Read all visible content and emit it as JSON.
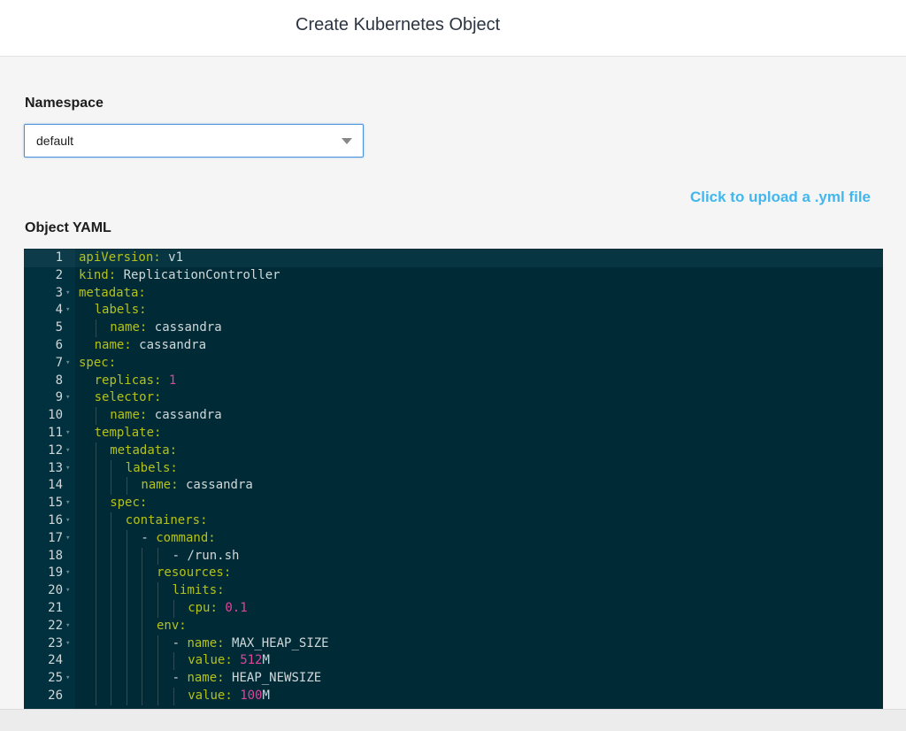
{
  "header": {
    "title": "Create Kubernetes Object"
  },
  "namespace": {
    "label": "Namespace",
    "selected": "default"
  },
  "upload": {
    "label": "Click to upload a .yml file"
  },
  "yaml": {
    "label": "Object YAML",
    "lines": [
      {
        "n": "1",
        "fold": false,
        "indent": 0,
        "parts": [
          [
            "k",
            "apiVersion:"
          ],
          [
            "v",
            " v1"
          ]
        ]
      },
      {
        "n": "2",
        "fold": false,
        "indent": 0,
        "parts": [
          [
            "k",
            "kind:"
          ],
          [
            "v",
            " ReplicationController"
          ]
        ]
      },
      {
        "n": "3",
        "fold": true,
        "indent": 0,
        "parts": [
          [
            "k",
            "metadata:"
          ]
        ]
      },
      {
        "n": "4",
        "fold": true,
        "indent": 1,
        "parts": [
          [
            "k",
            "labels:"
          ]
        ]
      },
      {
        "n": "5",
        "fold": false,
        "indent": 2,
        "parts": [
          [
            "k",
            "name:"
          ],
          [
            "v",
            " cassandra"
          ]
        ]
      },
      {
        "n": "6",
        "fold": false,
        "indent": 1,
        "parts": [
          [
            "k",
            "name:"
          ],
          [
            "v",
            " cassandra"
          ]
        ]
      },
      {
        "n": "7",
        "fold": true,
        "indent": 0,
        "parts": [
          [
            "k",
            "spec:"
          ]
        ]
      },
      {
        "n": "8",
        "fold": false,
        "indent": 1,
        "parts": [
          [
            "k",
            "replicas:"
          ],
          [
            "n",
            " 1"
          ]
        ]
      },
      {
        "n": "9",
        "fold": true,
        "indent": 1,
        "parts": [
          [
            "k",
            "selector:"
          ]
        ]
      },
      {
        "n": "10",
        "fold": false,
        "indent": 2,
        "parts": [
          [
            "k",
            "name:"
          ],
          [
            "v",
            " cassandra"
          ]
        ]
      },
      {
        "n": "11",
        "fold": true,
        "indent": 1,
        "parts": [
          [
            "k",
            "template:"
          ]
        ]
      },
      {
        "n": "12",
        "fold": true,
        "indent": 2,
        "parts": [
          [
            "k",
            "metadata:"
          ]
        ]
      },
      {
        "n": "13",
        "fold": true,
        "indent": 3,
        "parts": [
          [
            "k",
            "labels:"
          ]
        ]
      },
      {
        "n": "14",
        "fold": false,
        "indent": 4,
        "parts": [
          [
            "k",
            "name:"
          ],
          [
            "v",
            " cassandra"
          ]
        ]
      },
      {
        "n": "15",
        "fold": true,
        "indent": 2,
        "parts": [
          [
            "k",
            "spec:"
          ]
        ]
      },
      {
        "n": "16",
        "fold": true,
        "indent": 3,
        "parts": [
          [
            "k",
            "containers:"
          ]
        ]
      },
      {
        "n": "17",
        "fold": true,
        "indent": 4,
        "parts": [
          [
            "v",
            "- "
          ],
          [
            "k",
            "command:"
          ]
        ]
      },
      {
        "n": "18",
        "fold": false,
        "indent": 6,
        "parts": [
          [
            "v",
            "- /run.sh"
          ]
        ]
      },
      {
        "n": "19",
        "fold": true,
        "indent": 5,
        "parts": [
          [
            "k",
            "resources:"
          ]
        ]
      },
      {
        "n": "20",
        "fold": true,
        "indent": 6,
        "parts": [
          [
            "k",
            "limits:"
          ]
        ]
      },
      {
        "n": "21",
        "fold": false,
        "indent": 7,
        "parts": [
          [
            "k",
            "cpu:"
          ],
          [
            "n",
            " 0.1"
          ]
        ]
      },
      {
        "n": "22",
        "fold": true,
        "indent": 5,
        "parts": [
          [
            "k",
            "env:"
          ]
        ]
      },
      {
        "n": "23",
        "fold": true,
        "indent": 6,
        "parts": [
          [
            "v",
            "- "
          ],
          [
            "k",
            "name:"
          ],
          [
            "v",
            " MAX_HEAP_SIZE"
          ]
        ]
      },
      {
        "n": "24",
        "fold": false,
        "indent": 7,
        "parts": [
          [
            "k",
            "value:"
          ],
          [
            "n",
            " 512"
          ],
          [
            "v",
            "M"
          ]
        ]
      },
      {
        "n": "25",
        "fold": true,
        "indent": 6,
        "parts": [
          [
            "v",
            "- "
          ],
          [
            "k",
            "name:"
          ],
          [
            "v",
            " HEAP_NEWSIZE"
          ]
        ]
      },
      {
        "n": "26",
        "fold": false,
        "indent": 7,
        "parts": [
          [
            "k",
            "value:"
          ],
          [
            "n",
            " 100"
          ],
          [
            "v",
            "M"
          ]
        ]
      }
    ]
  },
  "colors": {
    "editor_bg": "#002b36",
    "key": "#b4c11a",
    "number": "#e0449a",
    "link": "#42b7ee"
  }
}
